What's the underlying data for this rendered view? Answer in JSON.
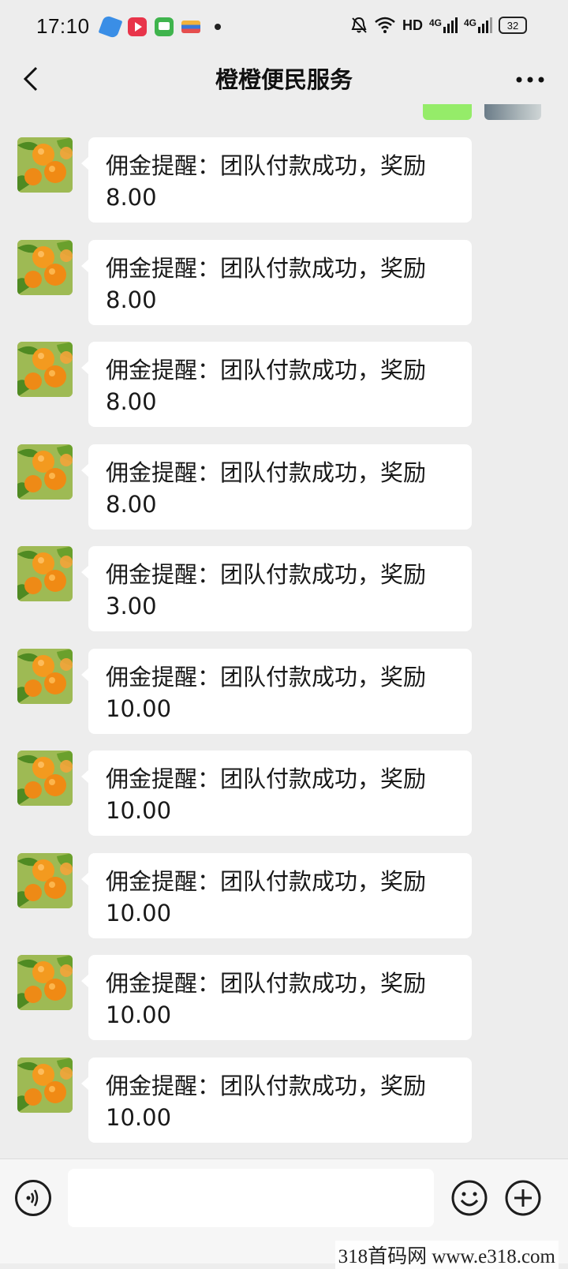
{
  "status_bar": {
    "time": "17:10",
    "network": "HD",
    "signal_1": "4G",
    "signal_2": "4G",
    "battery": "32"
  },
  "header": {
    "title": "橙橙便民服务"
  },
  "messages": [
    {
      "text": "佣金提醒：团队付款成功，奖励",
      "amount": "8.00"
    },
    {
      "text": "佣金提醒：团队付款成功，奖励",
      "amount": "8.00"
    },
    {
      "text": "佣金提醒：团队付款成功，奖励",
      "amount": "8.00"
    },
    {
      "text": "佣金提醒：团队付款成功，奖励",
      "amount": "8.00"
    },
    {
      "text": "佣金提醒：团队付款成功，奖励",
      "amount": "3.00"
    },
    {
      "text": "佣金提醒：团队付款成功，奖励",
      "amount": "10.00"
    },
    {
      "text": "佣金提醒：团队付款成功，奖励",
      "amount": "10.00"
    },
    {
      "text": "佣金提醒：团队付款成功，奖励",
      "amount": "10.00"
    },
    {
      "text": "佣金提醒：团队付款成功，奖励",
      "amount": "10.00"
    },
    {
      "text": "佣金提醒：团队付款成功，奖励",
      "amount": "10.00"
    }
  ],
  "input": {
    "value": ""
  },
  "watermark": "318首码网 www.e318.com",
  "colors": {
    "background": "#ededed",
    "bubble": "#ffffff",
    "sent_bubble": "#95ec69",
    "orange": "#f39a1f",
    "leaf": "#5a8f2a"
  }
}
